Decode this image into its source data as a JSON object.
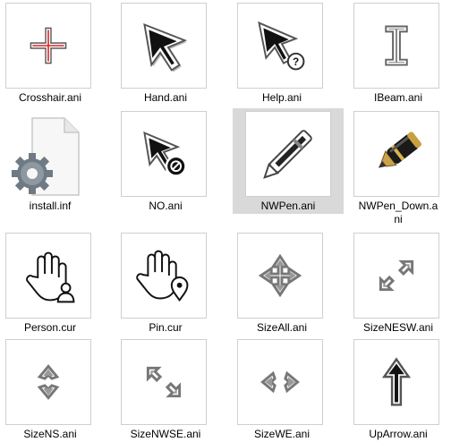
{
  "files": [
    {
      "name": "Crosshair.ani",
      "icon": "crosshair-cursor-icon"
    },
    {
      "name": "Hand.ani",
      "icon": "arrow-cursor-icon"
    },
    {
      "name": "Help.ani",
      "icon": "help-cursor-icon"
    },
    {
      "name": "IBeam.ani",
      "icon": "ibeam-cursor-icon"
    },
    {
      "name": "install.inf",
      "icon": "setup-file-icon"
    },
    {
      "name": "NO.ani",
      "icon": "no-cursor-icon"
    },
    {
      "name": "NWPen.ani",
      "icon": "pen-cursor-icon",
      "selected": true
    },
    {
      "name": "NWPen_Down.a",
      "name_line2": "ni",
      "icon": "fountain-pen-cursor-icon"
    },
    {
      "name": "Person.cur",
      "icon": "person-select-cursor-icon"
    },
    {
      "name": "Pin.cur",
      "icon": "pin-select-cursor-icon"
    },
    {
      "name": "SizeAll.ani",
      "icon": "move-cursor-icon"
    },
    {
      "name": "SizeNESW.ani",
      "icon": "resize-nesw-cursor-icon"
    },
    {
      "name": "SizeNS.ani",
      "icon": "resize-ns-cursor-icon"
    },
    {
      "name": "SizeNWSE.ani",
      "icon": "resize-nwse-cursor-icon"
    },
    {
      "name": "SizeWE.ani",
      "icon": "resize-we-cursor-icon"
    },
    {
      "name": "UpArrow.ani",
      "icon": "up-arrow-cursor-icon"
    }
  ],
  "colors": {
    "selection": "#d9d9d9",
    "thumb_border": "#cfcfcf"
  }
}
